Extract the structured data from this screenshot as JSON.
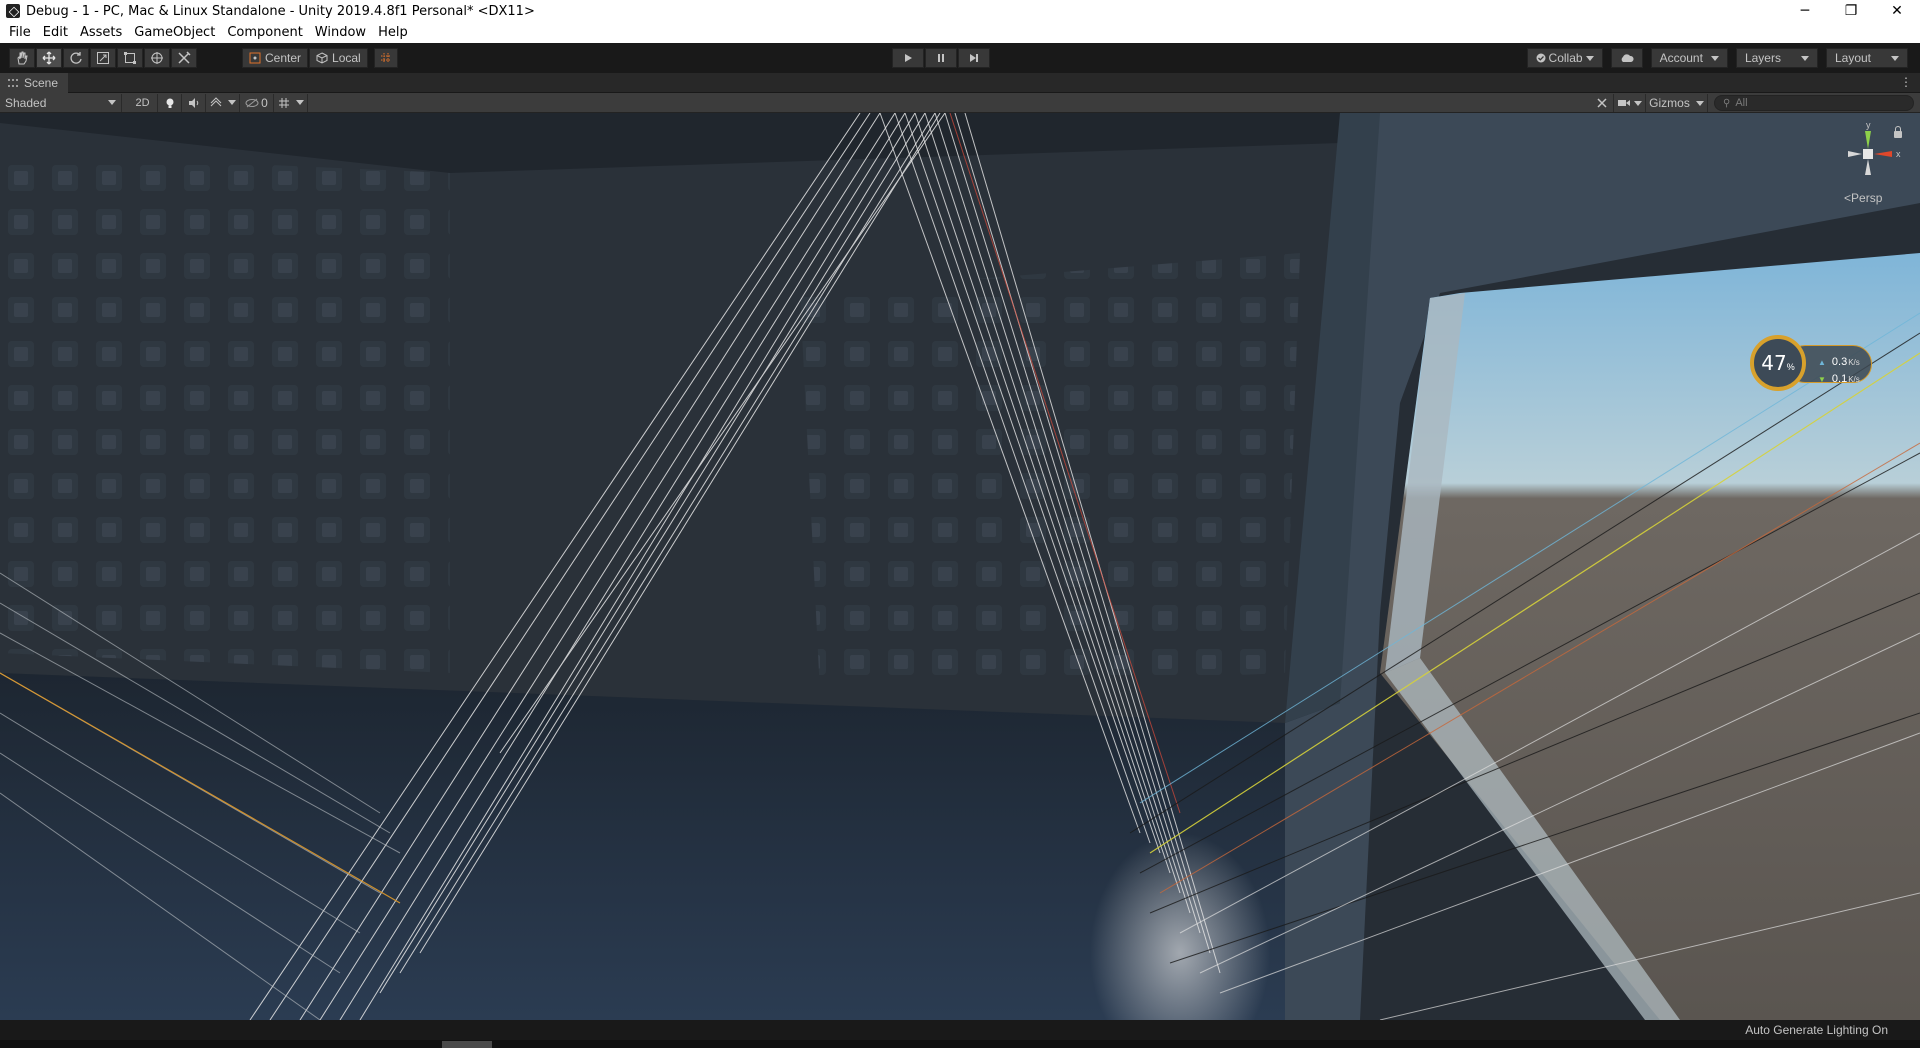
{
  "window": {
    "title": "Debug - 1 - PC, Mac & Linux Standalone - Unity 2019.4.8f1 Personal* <DX11>",
    "controls": {
      "minimize": "─",
      "maximize": "❐",
      "close": "✕"
    }
  },
  "menu": [
    "File",
    "Edit",
    "Assets",
    "GameObject",
    "Component",
    "Window",
    "Help"
  ],
  "toolbar": {
    "tools": [
      "hand-icon",
      "move-icon",
      "rotate-icon",
      "scale-icon",
      "rect-icon",
      "transform-icon",
      "custom-tool-icon"
    ],
    "pivot_label": "Center",
    "space_label": "Local",
    "collab_label": "Collab",
    "account_label": "Account",
    "layers_label": "Layers",
    "layout_label": "Layout"
  },
  "scene": {
    "tab_label": "Scene",
    "shading_mode": "Shaded",
    "mode_2d": "2D",
    "hidden_count": "0",
    "gizmos_label": "Gizmos",
    "search_placeholder": "All",
    "axis_x": "x",
    "axis_y": "y",
    "projection": "Persp"
  },
  "net_monitor": {
    "percent": "47",
    "percent_sign": "%",
    "upload": "0.3",
    "download": "0.1",
    "unit": "K/s"
  },
  "status": {
    "lighting": "Auto Generate Lighting On"
  },
  "colors": {
    "editor_bg": "#191919",
    "toolbar_button": "#383838",
    "scene_toolbar": "#3c3c3c",
    "monitor_ring": "#d8a12c"
  }
}
